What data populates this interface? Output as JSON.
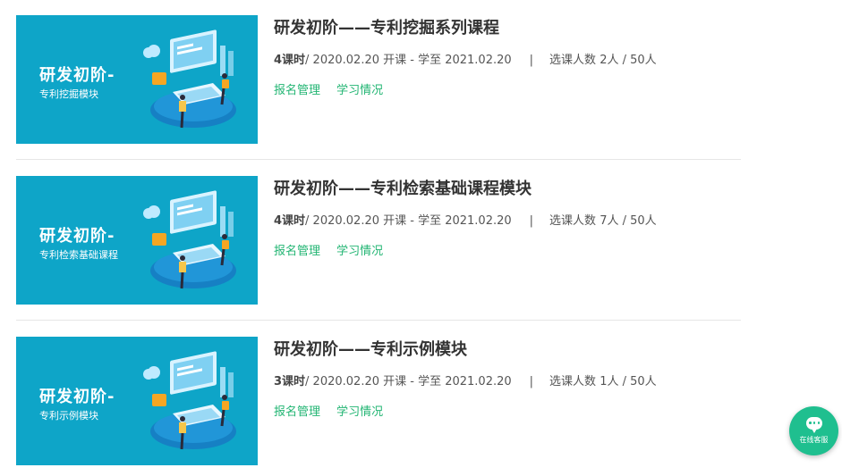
{
  "courses": [
    {
      "thumb_title": "研发初阶-",
      "thumb_subtitle": "专利挖掘模块",
      "title": "研发初阶——专利挖掘系列课程",
      "lessons": "4课时",
      "schedule": "/ 2020.02.20 开课 - 学至 2021.02.20",
      "separator": "|",
      "enroll_label": "选课人数 ",
      "enroll_count": "2人 / 50人",
      "actions": [
        "报名管理",
        "学习情况"
      ]
    },
    {
      "thumb_title": "研发初阶-",
      "thumb_subtitle": "专利检索基础课程",
      "title": "研发初阶——专利检索基础课程模块",
      "lessons": "4课时",
      "schedule": "/ 2020.02.20 开课 - 学至 2021.02.20",
      "separator": "|",
      "enroll_label": "选课人数 ",
      "enroll_count": "7人 / 50人",
      "actions": [
        "报名管理",
        "学习情况"
      ]
    },
    {
      "thumb_title": "研发初阶-",
      "thumb_subtitle": "专利示例模块",
      "title": "研发初阶——专利示例模块",
      "lessons": "3课时",
      "schedule": "/ 2020.02.20 开课 - 学至 2021.02.20",
      "separator": "|",
      "enroll_label": "选课人数 ",
      "enroll_count": "1人 / 50人",
      "actions": [
        "报名管理",
        "学习情况"
      ]
    }
  ],
  "chat_widget": {
    "label": "在线客服",
    "icon": "chat-bubble-icon"
  },
  "colors": {
    "thumb_background": "#0ea5c8",
    "action_link": "#22b573",
    "chat_widget": "#1fbf8f"
  }
}
